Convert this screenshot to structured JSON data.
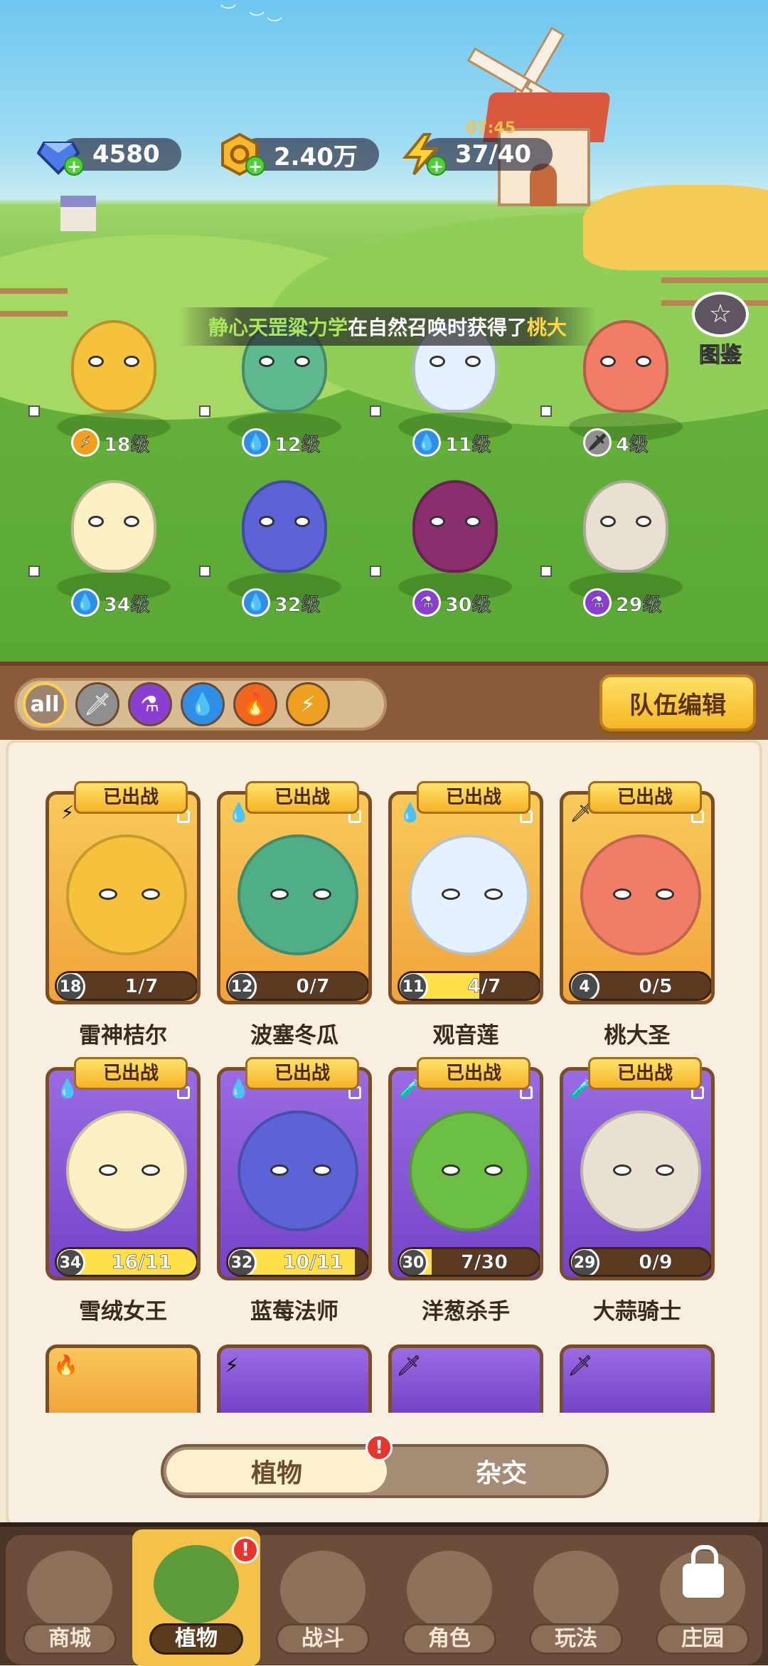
{
  "currencies": [
    {
      "name": "gem-counter",
      "value": "4580"
    },
    {
      "name": "coin-counter",
      "value": "2.40万"
    },
    {
      "name": "energy-counter",
      "value": "37/40",
      "timer": "07:45"
    }
  ],
  "notice": {
    "player": "静心天罡粱力学",
    "middle": "在自然召唤时获得了",
    "item": "桃大"
  },
  "album_label": "图鉴",
  "team": [
    {
      "level": "18级",
      "element": "lightning",
      "color": "#f6c23a"
    },
    {
      "level": "12级",
      "element": "water",
      "color": "#5fb98f"
    },
    {
      "level": "11级",
      "element": "water",
      "color": "#e4f2ff"
    },
    {
      "level": "4级",
      "element": "sword",
      "color": "#f27d66"
    },
    {
      "level": "34级",
      "element": "water",
      "color": "#fbf1c4"
    },
    {
      "level": "32级",
      "element": "water",
      "color": "#5b63d6"
    },
    {
      "level": "30级",
      "element": "poison",
      "color": "#8b2e6e"
    },
    {
      "level": "29级",
      "element": "poison",
      "color": "#e8e0d0"
    }
  ],
  "filters": [
    "all",
    "sword",
    "poison",
    "water",
    "fire",
    "lightning"
  ],
  "team_edit_label": "队伍编辑",
  "deployed_label": "已出战",
  "cards": [
    {
      "name": "雷神桔尔",
      "level": "18",
      "progress": "1/7",
      "fill": 0.14,
      "frame": "gold",
      "element": "⚡",
      "color": "#f6c23a"
    },
    {
      "name": "波塞冬瓜",
      "level": "12",
      "progress": "0/7",
      "fill": 0.0,
      "frame": "gold",
      "element": "💧",
      "color": "#4fae86"
    },
    {
      "name": "观音莲",
      "level": "11",
      "progress": "4/7",
      "fill": 0.57,
      "frame": "gold",
      "element": "💧",
      "color": "#e4f2ff"
    },
    {
      "name": "桃大圣",
      "level": "4",
      "progress": "0/5",
      "fill": 0.0,
      "frame": "gold",
      "element": "🗡",
      "color": "#f27d66"
    },
    {
      "name": "雪绒女王",
      "level": "34",
      "progress": "16/11",
      "fill": 1.0,
      "frame": "purp",
      "element": "💧",
      "color": "#fbf1c4"
    },
    {
      "name": "蓝莓法师",
      "level": "32",
      "progress": "10/11",
      "fill": 0.91,
      "frame": "purp",
      "element": "💧",
      "color": "#5b63d6"
    },
    {
      "name": "洋葱杀手",
      "level": "30",
      "progress": "7/30",
      "fill": 0.23,
      "frame": "purp",
      "element": "🧪",
      "color": "#6cbf45"
    },
    {
      "name": "大蒜骑士",
      "level": "29",
      "progress": "0/9",
      "fill": 0.0,
      "frame": "purp",
      "element": "🧪",
      "color": "#e8e0d0"
    }
  ],
  "toggle": {
    "active": "植物",
    "inactive": "杂交",
    "badge": "!"
  },
  "nav": [
    {
      "label": "商城",
      "active": false
    },
    {
      "label": "植物",
      "active": true,
      "badge": "!"
    },
    {
      "label": "战斗",
      "active": false
    },
    {
      "label": "角色",
      "active": false
    },
    {
      "label": "玩法",
      "active": false
    },
    {
      "label": "庄园",
      "active": false,
      "locked": true
    }
  ]
}
